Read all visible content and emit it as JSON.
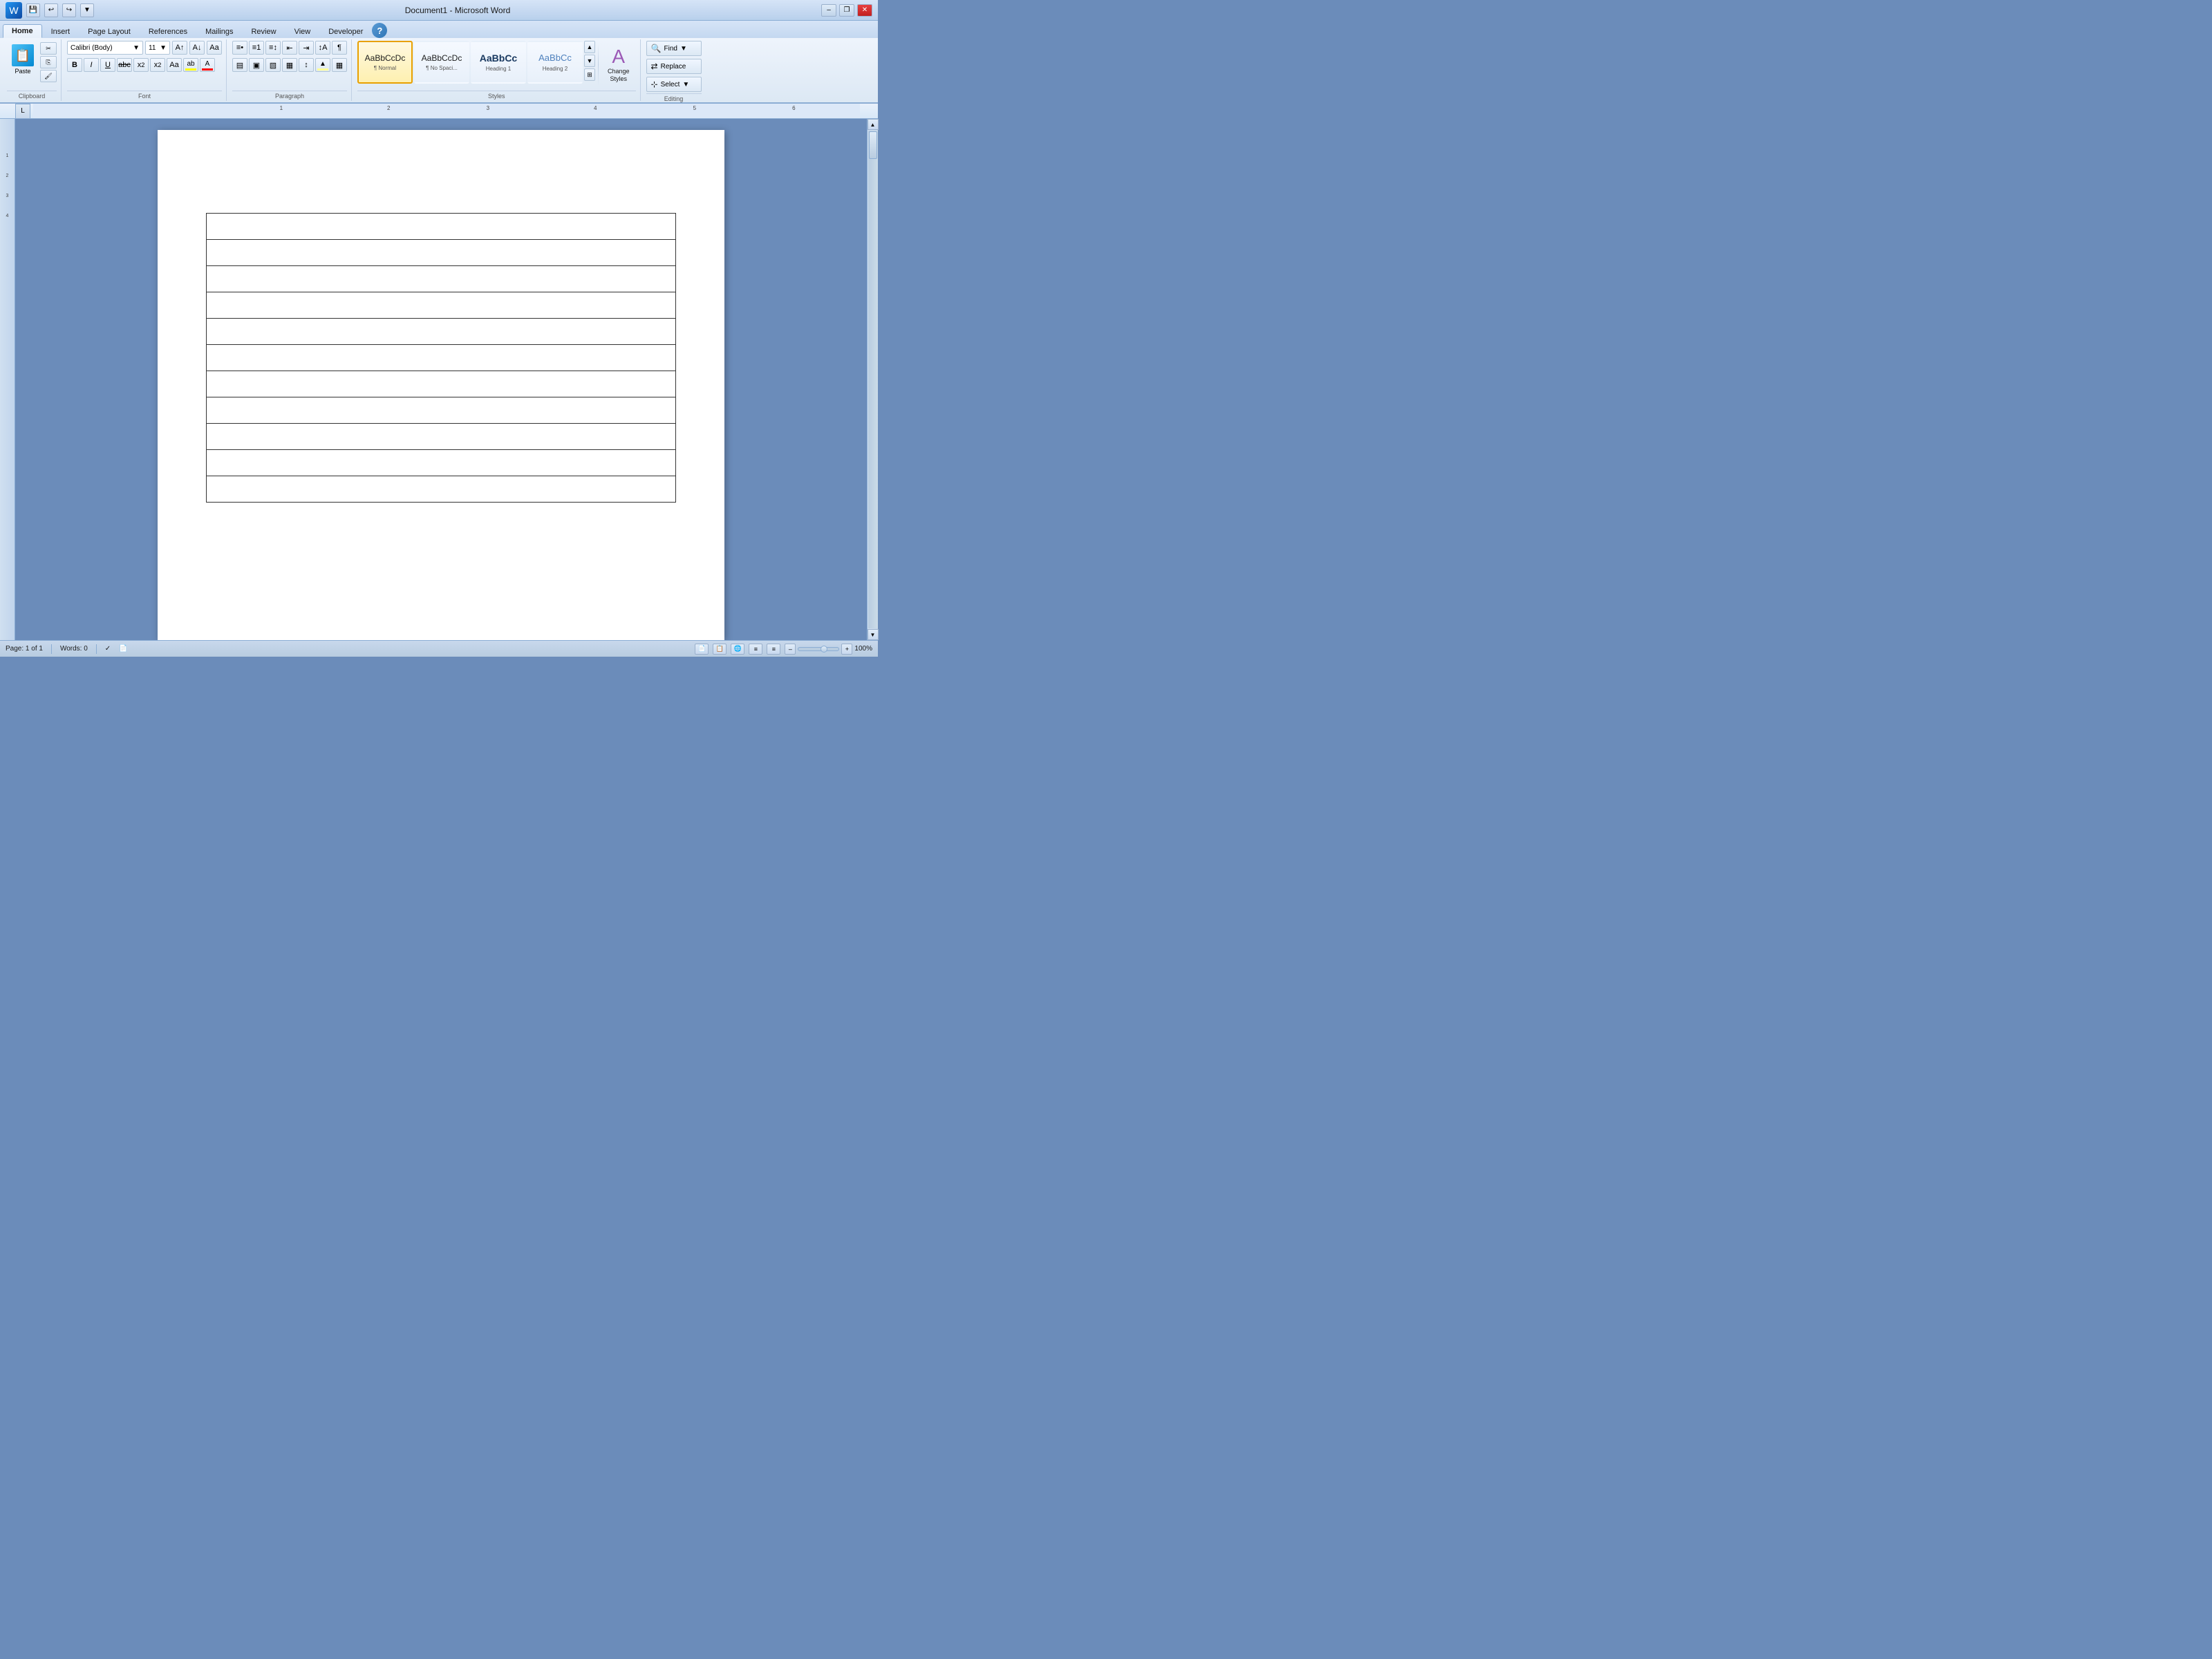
{
  "titleBar": {
    "title": "Document1 - Microsoft Word",
    "minimizeLabel": "–",
    "restoreLabel": "❐",
    "closeLabel": "✕",
    "quickAccess": {
      "save": "💾",
      "undo": "↩",
      "redo": "↪",
      "dropdown": "▼"
    }
  },
  "tabs": [
    {
      "label": "Home",
      "active": true
    },
    {
      "label": "Insert",
      "active": false
    },
    {
      "label": "Page Layout",
      "active": false
    },
    {
      "label": "References",
      "active": false
    },
    {
      "label": "Mailings",
      "active": false
    },
    {
      "label": "Review",
      "active": false
    },
    {
      "label": "View",
      "active": false
    },
    {
      "label": "Developer",
      "active": false
    }
  ],
  "ribbon": {
    "clipboard": {
      "label": "Clipboard",
      "pasteLabel": "Paste",
      "cutLabel": "✂",
      "copyLabel": "⎘",
      "formatPainterLabel": "🖌"
    },
    "font": {
      "label": "Font",
      "fontName": "Calibri (Body)",
      "fontSize": "11",
      "boldLabel": "B",
      "italicLabel": "I",
      "underlineLabel": "U",
      "strikethroughLabel": "abc",
      "subscriptLabel": "x₂",
      "superscriptLabel": "x²",
      "clearFormatLabel": "Aa",
      "fontColorLabel": "A",
      "highlightLabel": "ab"
    },
    "paragraph": {
      "label": "Paragraph",
      "bulletsLabel": "≡•",
      "numberingLabel": "≡1",
      "multiLevelLabel": "≡↕",
      "decreaseIndentLabel": "⇤",
      "increaseIndentLabel": "⇥",
      "sortLabel": "↕A",
      "showHideLabel": "¶",
      "alignLeftLabel": "≡",
      "centerLabel": "≡",
      "alignRightLabel": "≡",
      "justifyLabel": "≡",
      "lineSpacingLabel": "↕",
      "shadingLabel": "🎨",
      "bordersLabel": "▦"
    },
    "styles": {
      "label": "Styles",
      "items": [
        {
          "label": "¶ Normal",
          "sublabel": "Normal",
          "active": true
        },
        {
          "label": "¶ No Spaci...",
          "sublabel": "No Spaci...",
          "active": false
        },
        {
          "label": "AaBbCc",
          "sublabel": "Heading 1",
          "active": false
        },
        {
          "label": "AaBbCc",
          "sublabel": "Heading 2",
          "active": false
        }
      ],
      "changeStylesLabel": "Change\nStyles",
      "expandLabel": "▼"
    },
    "editing": {
      "label": "Editing",
      "findLabel": "Find",
      "replaceLabel": "Replace",
      "selectLabel": "Select"
    }
  },
  "document": {
    "tableRows": 11,
    "tableColumns": 1
  },
  "statusBar": {
    "page": "Page: 1 of 1",
    "words": "Words: 0",
    "language": "✓",
    "viewPrint": "📄",
    "viewFull": "📋",
    "viewWeb": "🌐",
    "viewOutline": "≡",
    "viewDraft": "≡",
    "zoom": "100%",
    "zoomOut": "–",
    "zoomIn": "+"
  }
}
